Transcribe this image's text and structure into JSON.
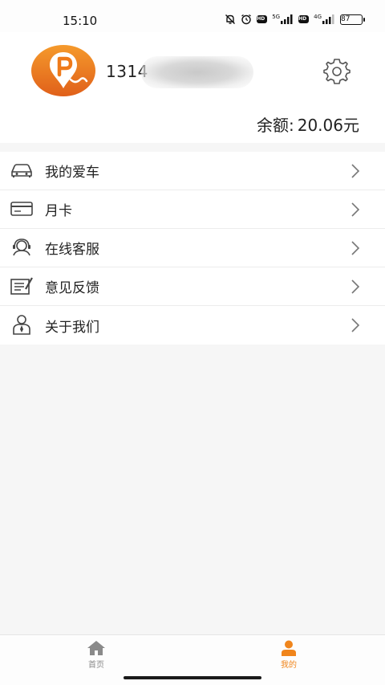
{
  "status_bar": {
    "time": "15:10",
    "signal_1_label": "5G",
    "signal_2_label": "4G",
    "hd_label": "HD",
    "battery": "87"
  },
  "profile": {
    "username": "1314",
    "balance_label": "余额:",
    "balance_value": "20.06元",
    "brand_color": "#ef7a1a"
  },
  "menu": {
    "items": [
      {
        "label": "我的爱车",
        "icon": "car-icon"
      },
      {
        "label": "月卡",
        "icon": "card-icon"
      },
      {
        "label": "在线客服",
        "icon": "headset-icon"
      },
      {
        "label": "意见反馈",
        "icon": "feedback-icon"
      },
      {
        "label": "关于我们",
        "icon": "person-icon"
      }
    ]
  },
  "tab_bar": {
    "tabs": [
      {
        "label": "首页",
        "icon": "home-icon",
        "active": false
      },
      {
        "label": "我的",
        "icon": "user-icon",
        "active": true
      }
    ],
    "active_color": "#f0851c",
    "inactive_color": "#8a8a8a"
  }
}
